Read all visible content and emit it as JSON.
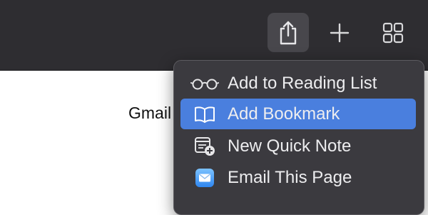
{
  "toolbar": {
    "buttons": [
      {
        "icon": "share-icon",
        "active": true
      },
      {
        "icon": "plus-icon",
        "active": false
      },
      {
        "icon": "tab-overview-icon",
        "active": false
      }
    ]
  },
  "page": {
    "visible_text": "Gmail"
  },
  "share_menu": {
    "items": [
      {
        "label": "Add to Reading List",
        "icon": "reading-glasses-icon",
        "selected": false
      },
      {
        "label": "Add Bookmark",
        "icon": "book-icon",
        "selected": true
      },
      {
        "label": "New Quick Note",
        "icon": "quick-note-icon",
        "selected": false
      },
      {
        "label": "Email This Page",
        "icon": "mail-icon",
        "selected": false
      }
    ]
  },
  "colors": {
    "toolbar_bg": "#2e2d31",
    "menu_bg": "#3b3a3f",
    "selection": "#4a7fde",
    "menu_text": "#ededef"
  }
}
